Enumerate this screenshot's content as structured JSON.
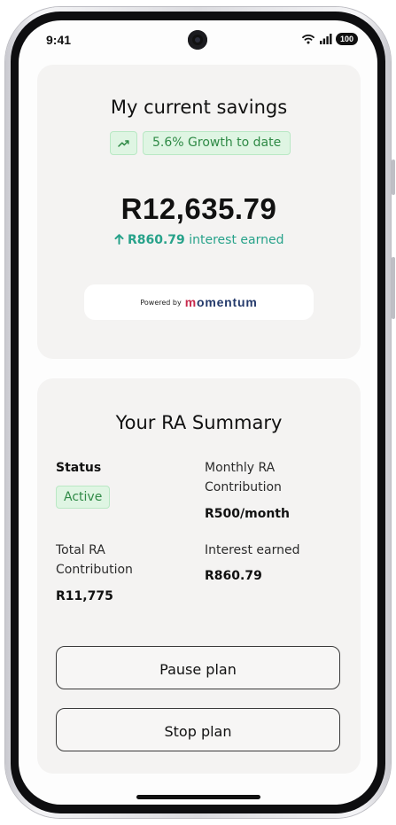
{
  "status_bar": {
    "time": "9:41",
    "battery": "100"
  },
  "savings": {
    "title": "My current savings",
    "growth_badge": "5.6% Growth to date",
    "amount": "R12,635.79",
    "interest_amount": "R860.79",
    "interest_label": "interest earned",
    "powered_by": "Powered by",
    "brand": "momentum"
  },
  "summary": {
    "title": "Your RA Summary",
    "status_label": "Status",
    "status_value": "Active",
    "monthly_label": "Monthly RA Contribution",
    "monthly_value": "R500/month",
    "total_label": "Total RA Contribution",
    "total_value": "R11,775",
    "interest_label": "Interest earned",
    "interest_value": "R860.79"
  },
  "actions": {
    "pause": "Pause plan",
    "stop": "Stop plan"
  },
  "colors": {
    "accent_green": "#27a28a",
    "badge_green_bg": "#dff5e3",
    "badge_green_text": "#2f8a46",
    "brand_navy": "#243a6b",
    "brand_red": "#c72a4d",
    "card_bg": "#f4f3f2"
  },
  "icons": {
    "growth": "trending-up-icon",
    "interest": "arrow-up-icon",
    "wifi": "wifi-icon",
    "signal": "signal-icon",
    "battery": "battery-icon"
  }
}
